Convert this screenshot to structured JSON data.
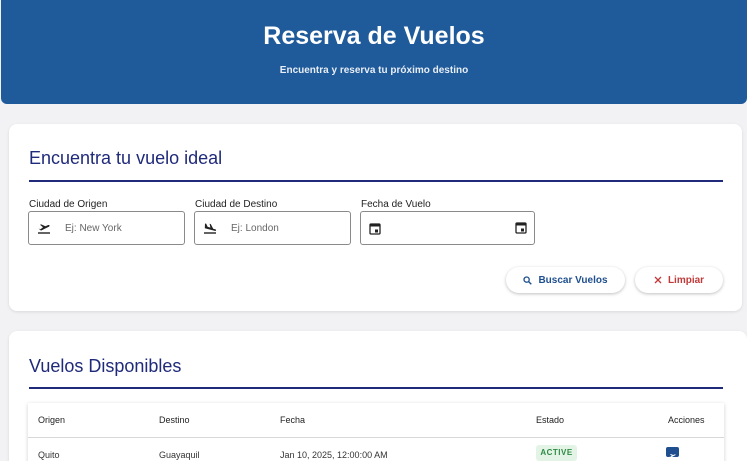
{
  "header": {
    "title": "Reserva de Vuelos",
    "subtitle": "Encuentra y reserva tu próximo destino"
  },
  "search": {
    "title": "Encuentra tu vuelo ideal",
    "origin": {
      "label": "Ciudad de Origen",
      "placeholder": "Ej: New York",
      "icon": "flight-takeoff-icon"
    },
    "destination": {
      "label": "Ciudad de Destino",
      "placeholder": "Ej: London",
      "icon": "flight-land-icon"
    },
    "date": {
      "label": "Fecha de Vuelo",
      "value": "",
      "icon": "calendar-icon"
    },
    "search_button": "Buscar Vuelos",
    "clear_button": "Limpiar"
  },
  "flights": {
    "title": "Vuelos Disponibles",
    "columns": [
      "Origen",
      "Destino",
      "Fecha",
      "Estado",
      "Acciones"
    ],
    "rows": [
      {
        "origin": "Quito",
        "destination": "Guayaquil",
        "date": "Jan 10, 2025, 12:00:00 AM",
        "status": "ACTIVE"
      }
    ]
  },
  "colors": {
    "header_bg": "#1f5a9a",
    "section_title": "#1f2a7a",
    "status_active_bg": "#e3f4e6",
    "status_active_text": "#2e8a43",
    "clear_text": "#c03a3a"
  }
}
